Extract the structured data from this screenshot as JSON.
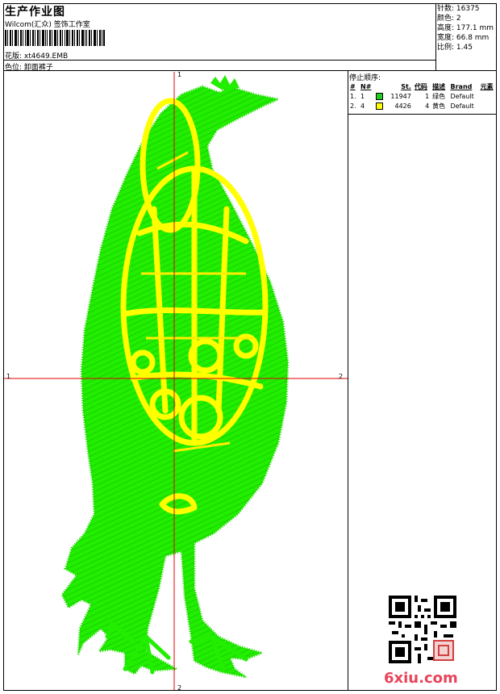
{
  "header": {
    "title": "生产作业图",
    "subtitle": "Wilcom(汇众) 签饰工作室",
    "pattern_label": "花版:",
    "pattern_value": "xt4649.EMB",
    "colorway_label": "色位:",
    "colorway_value": "卸面裤子"
  },
  "stats": {
    "stitches": "针数: 16375",
    "colors": "颜色: 2",
    "height": "高度: 177.1 mm",
    "width": "宽度: 66.8 mm",
    "scale": "比例: 1.45"
  },
  "stop_sequence": {
    "title": "停止顺序:",
    "columns": [
      "#",
      "N#",
      "St.",
      "代码",
      "描述",
      "Brand",
      "元素"
    ],
    "rows": [
      {
        "index": "1.",
        "needle": "1",
        "swatch_color": "#22cc22",
        "stitches": "11947",
        "code": "1",
        "description": "绿色",
        "brand": "Default"
      },
      {
        "index": "2.",
        "needle": "4",
        "swatch_color": "#ffff00",
        "stitches": "4426",
        "code": "4",
        "description": "黄色",
        "brand": "Default"
      }
    ]
  },
  "axes": {
    "top": "1",
    "bottom": "2",
    "left": "1",
    "right": "2"
  },
  "colors": {
    "primary_thread": "#22ee00",
    "secondary_thread": "#ffff00",
    "crosshair": "#e00000",
    "watermark": "#e8445a"
  },
  "watermark": "6xiu.com"
}
